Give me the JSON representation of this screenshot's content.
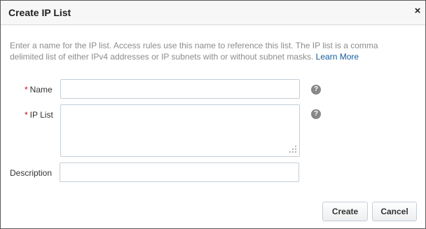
{
  "dialog": {
    "title": "Create IP List",
    "close_glyph": "×",
    "close_icon": "close-icon",
    "intro_text": "Enter a name for the IP list. Access rules use this name to reference this list. The IP list is a comma delimited list of either IPv4 addresses or IP subnets with or without subnet masks.",
    "learn_more_label": "Learn More",
    "link_color": "#145c9e",
    "required_marker": "*",
    "required_color": "#c60c0c"
  },
  "form": {
    "name": {
      "label": "Name",
      "value": "",
      "help_icon": "help-icon",
      "help_glyph": "?"
    },
    "ip_list": {
      "label": "IP List",
      "value": "",
      "help_icon": "help-icon",
      "help_glyph": "?"
    },
    "description": {
      "label": "Description",
      "value": ""
    }
  },
  "buttons": {
    "create_label": "Create",
    "cancel_label": "Cancel"
  }
}
